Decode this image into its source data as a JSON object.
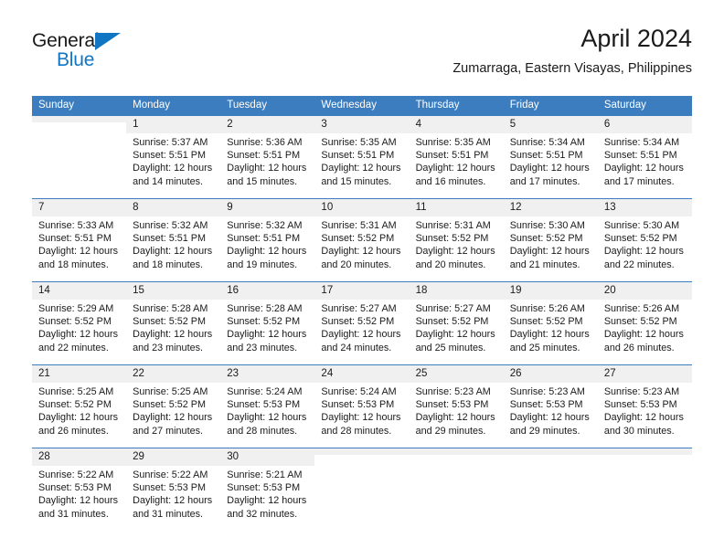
{
  "logo": {
    "word1": "General",
    "word2": "Blue",
    "triangle_color": "#1076c4"
  },
  "header": {
    "title": "April 2024",
    "location": "Zumarraga, Eastern Visayas, Philippines"
  },
  "theme": {
    "header_blue": "#3b7dbf",
    "daynum_gray": "#f0f0f0"
  },
  "weekdays": [
    "Sunday",
    "Monday",
    "Tuesday",
    "Wednesday",
    "Thursday",
    "Friday",
    "Saturday"
  ],
  "weeks": [
    [
      {
        "day": "",
        "sunrise": "",
        "sunset": "",
        "daylight1": "",
        "daylight2": ""
      },
      {
        "day": "1",
        "sunrise": "Sunrise: 5:37 AM",
        "sunset": "Sunset: 5:51 PM",
        "daylight1": "Daylight: 12 hours",
        "daylight2": "and 14 minutes."
      },
      {
        "day": "2",
        "sunrise": "Sunrise: 5:36 AM",
        "sunset": "Sunset: 5:51 PM",
        "daylight1": "Daylight: 12 hours",
        "daylight2": "and 15 minutes."
      },
      {
        "day": "3",
        "sunrise": "Sunrise: 5:35 AM",
        "sunset": "Sunset: 5:51 PM",
        "daylight1": "Daylight: 12 hours",
        "daylight2": "and 15 minutes."
      },
      {
        "day": "4",
        "sunrise": "Sunrise: 5:35 AM",
        "sunset": "Sunset: 5:51 PM",
        "daylight1": "Daylight: 12 hours",
        "daylight2": "and 16 minutes."
      },
      {
        "day": "5",
        "sunrise": "Sunrise: 5:34 AM",
        "sunset": "Sunset: 5:51 PM",
        "daylight1": "Daylight: 12 hours",
        "daylight2": "and 17 minutes."
      },
      {
        "day": "6",
        "sunrise": "Sunrise: 5:34 AM",
        "sunset": "Sunset: 5:51 PM",
        "daylight1": "Daylight: 12 hours",
        "daylight2": "and 17 minutes."
      }
    ],
    [
      {
        "day": "7",
        "sunrise": "Sunrise: 5:33 AM",
        "sunset": "Sunset: 5:51 PM",
        "daylight1": "Daylight: 12 hours",
        "daylight2": "and 18 minutes."
      },
      {
        "day": "8",
        "sunrise": "Sunrise: 5:32 AM",
        "sunset": "Sunset: 5:51 PM",
        "daylight1": "Daylight: 12 hours",
        "daylight2": "and 18 minutes."
      },
      {
        "day": "9",
        "sunrise": "Sunrise: 5:32 AM",
        "sunset": "Sunset: 5:51 PM",
        "daylight1": "Daylight: 12 hours",
        "daylight2": "and 19 minutes."
      },
      {
        "day": "10",
        "sunrise": "Sunrise: 5:31 AM",
        "sunset": "Sunset: 5:52 PM",
        "daylight1": "Daylight: 12 hours",
        "daylight2": "and 20 minutes."
      },
      {
        "day": "11",
        "sunrise": "Sunrise: 5:31 AM",
        "sunset": "Sunset: 5:52 PM",
        "daylight1": "Daylight: 12 hours",
        "daylight2": "and 20 minutes."
      },
      {
        "day": "12",
        "sunrise": "Sunrise: 5:30 AM",
        "sunset": "Sunset: 5:52 PM",
        "daylight1": "Daylight: 12 hours",
        "daylight2": "and 21 minutes."
      },
      {
        "day": "13",
        "sunrise": "Sunrise: 5:30 AM",
        "sunset": "Sunset: 5:52 PM",
        "daylight1": "Daylight: 12 hours",
        "daylight2": "and 22 minutes."
      }
    ],
    [
      {
        "day": "14",
        "sunrise": "Sunrise: 5:29 AM",
        "sunset": "Sunset: 5:52 PM",
        "daylight1": "Daylight: 12 hours",
        "daylight2": "and 22 minutes."
      },
      {
        "day": "15",
        "sunrise": "Sunrise: 5:28 AM",
        "sunset": "Sunset: 5:52 PM",
        "daylight1": "Daylight: 12 hours",
        "daylight2": "and 23 minutes."
      },
      {
        "day": "16",
        "sunrise": "Sunrise: 5:28 AM",
        "sunset": "Sunset: 5:52 PM",
        "daylight1": "Daylight: 12 hours",
        "daylight2": "and 23 minutes."
      },
      {
        "day": "17",
        "sunrise": "Sunrise: 5:27 AM",
        "sunset": "Sunset: 5:52 PM",
        "daylight1": "Daylight: 12 hours",
        "daylight2": "and 24 minutes."
      },
      {
        "day": "18",
        "sunrise": "Sunrise: 5:27 AM",
        "sunset": "Sunset: 5:52 PM",
        "daylight1": "Daylight: 12 hours",
        "daylight2": "and 25 minutes."
      },
      {
        "day": "19",
        "sunrise": "Sunrise: 5:26 AM",
        "sunset": "Sunset: 5:52 PM",
        "daylight1": "Daylight: 12 hours",
        "daylight2": "and 25 minutes."
      },
      {
        "day": "20",
        "sunrise": "Sunrise: 5:26 AM",
        "sunset": "Sunset: 5:52 PM",
        "daylight1": "Daylight: 12 hours",
        "daylight2": "and 26 minutes."
      }
    ],
    [
      {
        "day": "21",
        "sunrise": "Sunrise: 5:25 AM",
        "sunset": "Sunset: 5:52 PM",
        "daylight1": "Daylight: 12 hours",
        "daylight2": "and 26 minutes."
      },
      {
        "day": "22",
        "sunrise": "Sunrise: 5:25 AM",
        "sunset": "Sunset: 5:52 PM",
        "daylight1": "Daylight: 12 hours",
        "daylight2": "and 27 minutes."
      },
      {
        "day": "23",
        "sunrise": "Sunrise: 5:24 AM",
        "sunset": "Sunset: 5:53 PM",
        "daylight1": "Daylight: 12 hours",
        "daylight2": "and 28 minutes."
      },
      {
        "day": "24",
        "sunrise": "Sunrise: 5:24 AM",
        "sunset": "Sunset: 5:53 PM",
        "daylight1": "Daylight: 12 hours",
        "daylight2": "and 28 minutes."
      },
      {
        "day": "25",
        "sunrise": "Sunrise: 5:23 AM",
        "sunset": "Sunset: 5:53 PM",
        "daylight1": "Daylight: 12 hours",
        "daylight2": "and 29 minutes."
      },
      {
        "day": "26",
        "sunrise": "Sunrise: 5:23 AM",
        "sunset": "Sunset: 5:53 PM",
        "daylight1": "Daylight: 12 hours",
        "daylight2": "and 29 minutes."
      },
      {
        "day": "27",
        "sunrise": "Sunrise: 5:23 AM",
        "sunset": "Sunset: 5:53 PM",
        "daylight1": "Daylight: 12 hours",
        "daylight2": "and 30 minutes."
      }
    ],
    [
      {
        "day": "28",
        "sunrise": "Sunrise: 5:22 AM",
        "sunset": "Sunset: 5:53 PM",
        "daylight1": "Daylight: 12 hours",
        "daylight2": "and 31 minutes."
      },
      {
        "day": "29",
        "sunrise": "Sunrise: 5:22 AM",
        "sunset": "Sunset: 5:53 PM",
        "daylight1": "Daylight: 12 hours",
        "daylight2": "and 31 minutes."
      },
      {
        "day": "30",
        "sunrise": "Sunrise: 5:21 AM",
        "sunset": "Sunset: 5:53 PM",
        "daylight1": "Daylight: 12 hours",
        "daylight2": "and 32 minutes."
      },
      {
        "day": "",
        "sunrise": "",
        "sunset": "",
        "daylight1": "",
        "daylight2": ""
      },
      {
        "day": "",
        "sunrise": "",
        "sunset": "",
        "daylight1": "",
        "daylight2": ""
      },
      {
        "day": "",
        "sunrise": "",
        "sunset": "",
        "daylight1": "",
        "daylight2": ""
      },
      {
        "day": "",
        "sunrise": "",
        "sunset": "",
        "daylight1": "",
        "daylight2": ""
      }
    ]
  ]
}
